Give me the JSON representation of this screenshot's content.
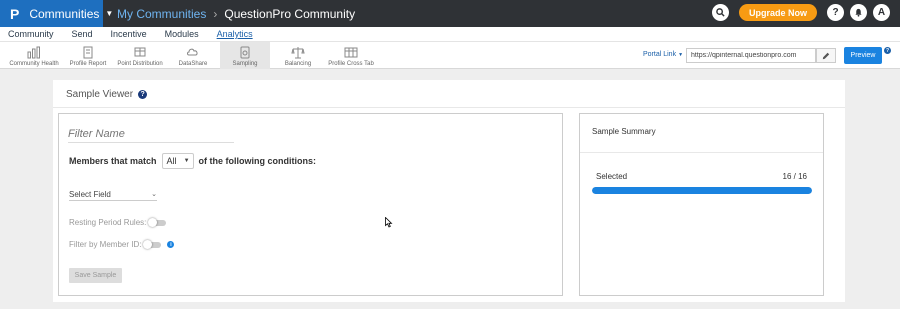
{
  "topbar": {
    "brand_logo": "P",
    "brand_name": "Communities",
    "breadcrumb_link": "My Communities",
    "breadcrumb_current": "QuestionPro Community",
    "upgrade_label": "Upgrade Now",
    "help_glyph": "?",
    "avatar_letter": "A",
    "icons": [
      "search-icon",
      "bell-icon"
    ]
  },
  "menu": {
    "items": [
      {
        "label": "Community"
      },
      {
        "label": "Send"
      },
      {
        "label": "Incentive"
      },
      {
        "label": "Modules"
      },
      {
        "label": "Analytics"
      }
    ],
    "active_index": 4
  },
  "toolbar": {
    "tools": [
      {
        "label": "Community Health",
        "icon": "bar-chart-icon"
      },
      {
        "label": "Profile Report",
        "icon": "profile-report-icon"
      },
      {
        "label": "Point Distribution",
        "icon": "point-distribution-icon"
      },
      {
        "label": "DataShare",
        "icon": "datashare-icon"
      },
      {
        "label": "Sampling",
        "icon": "sampling-icon"
      },
      {
        "label": "Balancing",
        "icon": "balance-scale-icon"
      },
      {
        "label": "Profile Cross Tab",
        "icon": "cross-tab-icon"
      }
    ],
    "active_index": 4,
    "portal_label": "Portal Link",
    "portal_url": "https://qpinternal.questionpro.com",
    "preview_label": "Preview",
    "help_glyph": "?"
  },
  "panel": {
    "title": "Sample Viewer",
    "help_glyph": "?"
  },
  "filter": {
    "name_placeholder": "Filter Name",
    "members_match_label": "Members that match",
    "match_value": "All",
    "conditions_label": "of the following conditions:",
    "select_field_label": "Select Field",
    "resting_label": "Resting Period Rules:",
    "member_id_label": "Filter by Member ID:",
    "info_glyph": "i",
    "save_label": "Save Sample"
  },
  "summary": {
    "title": "Sample Summary",
    "selected_label": "Selected",
    "selected_count": "16 / 16",
    "progress_fraction": 1.0
  },
  "colors": {
    "brand_blue": "#1e6fbf",
    "topbar_dark": "#2f3236",
    "upgrade_orange": "#f79b13",
    "primary_blue": "#1a83e0"
  }
}
